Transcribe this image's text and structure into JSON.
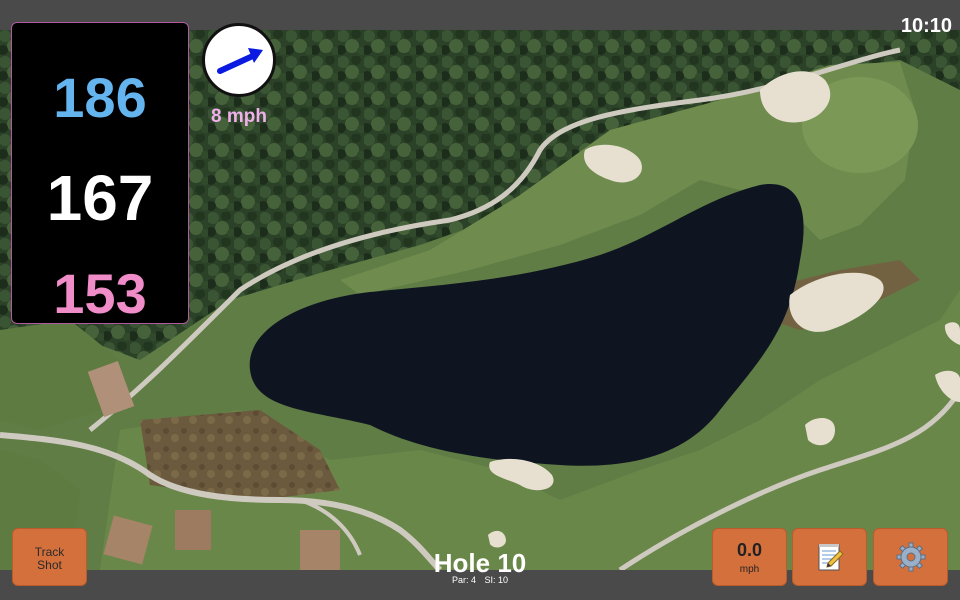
{
  "status_bar": {
    "time": "10:10"
  },
  "distances": {
    "back": "186",
    "middle": "167",
    "front": "153"
  },
  "wind": {
    "speed": "8 mph",
    "icon": "wind-arrow-icon"
  },
  "hole": {
    "title": "Hole 10",
    "par": "Par: 4",
    "stroke_index": "SI: 10"
  },
  "buttons": {
    "track_shot_line1": "Track",
    "track_shot_line2": "Shot",
    "speed_value": "0.0",
    "speed_unit": "mph",
    "notes_icon": "notepad-icon",
    "settings_icon": "gear-icon"
  },
  "colors": {
    "back_distance": "#64b4f0",
    "middle_distance": "#ffffff",
    "front_distance": "#f08cc8",
    "button_accent": "#d4703c",
    "wind_label": "#f0b0ec"
  }
}
